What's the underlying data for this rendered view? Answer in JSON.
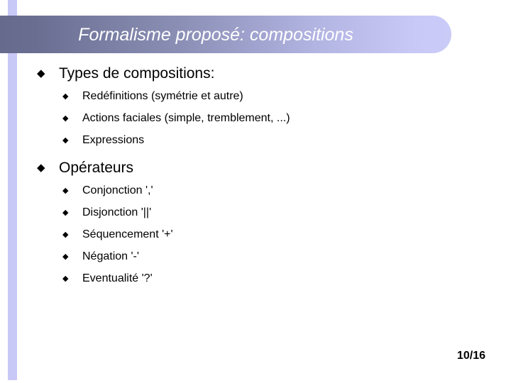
{
  "slide": {
    "title": "Formalisme proposé: compositions",
    "page_number": "10/16",
    "colors": {
      "stripe": "#c9c9f7",
      "banner_left": "#666b8e",
      "banner_right": "#c9c9f7",
      "title_text": "#ffffff",
      "body_text": "#000000",
      "background": "#ffffff"
    },
    "bullets": {
      "level1_glyph": "◆",
      "level2_glyph": "◆"
    },
    "sections": [
      {
        "heading": "Types de compositions:",
        "items": [
          "Redéfinitions (symétrie et autre)",
          "Actions faciales (simple, tremblement, ...)",
          "Expressions"
        ]
      },
      {
        "heading": "Opérateurs",
        "items": [
          "Conjonction ','",
          "Disjonction '||'",
          "Séquencement '+'",
          "Négation '-'",
          "Eventualité '?'"
        ]
      }
    ]
  }
}
